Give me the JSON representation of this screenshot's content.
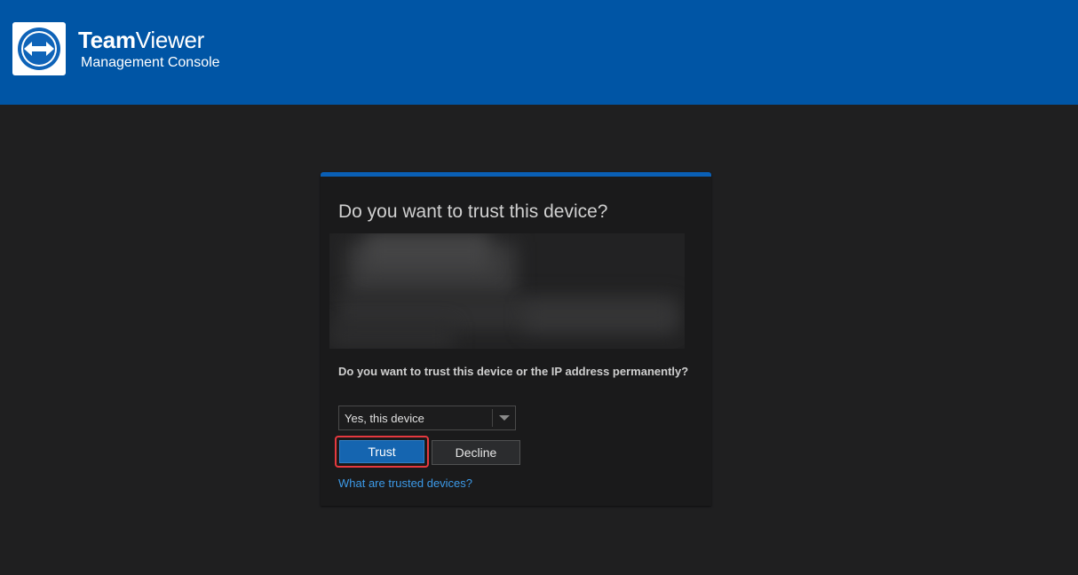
{
  "header": {
    "brand_bold": "Team",
    "brand_regular": "Viewer",
    "subtitle": "Management Console"
  },
  "dialog": {
    "title": "Do you want to trust this device?",
    "question": "Do you want to trust this device or the IP address permanently?",
    "select": {
      "value": "Yes, this device"
    },
    "trust_label": "Trust",
    "decline_label": "Decline",
    "help_link": "What are trusted devices?"
  },
  "colors": {
    "header_bg": "#0055a5",
    "accent": "#0a5fb5",
    "trust_button": "#1565b0",
    "highlight_outline": "#e5393f",
    "link": "#3c9ae8"
  },
  "icons": {
    "logo": "teamviewer-double-arrow-icon",
    "dropdown": "chevron-down-icon"
  }
}
